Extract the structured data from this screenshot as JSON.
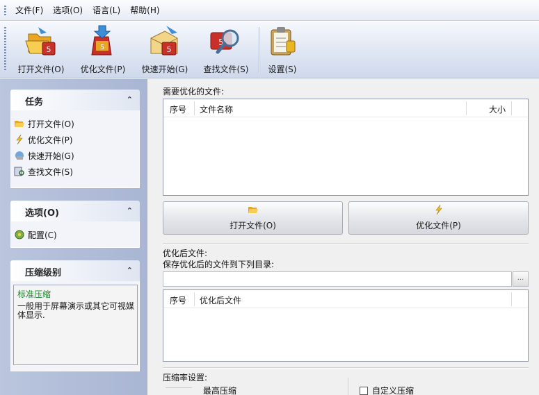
{
  "menu": [
    "文件(F)",
    "选项(O)",
    "语言(L)",
    "帮助(H)"
  ],
  "toolbar": {
    "open": "打开文件(O)",
    "optimize": "优化文件(P)",
    "quick": "快速开始(G)",
    "find": "查找文件(S)",
    "settings": "设置(S)"
  },
  "tasks": {
    "title": "任务",
    "items": [
      "打开文件(O)",
      "优化文件(P)",
      "快速开始(G)",
      "查找文件(S)"
    ]
  },
  "options": {
    "title": "选项(O)",
    "items": [
      "配置(C)"
    ]
  },
  "compression": {
    "title": "压缩级别",
    "level": "标准压缩",
    "description": "一般用于屏幕演示或其它可视媒体显示."
  },
  "files": {
    "label": "需要优化的文件:",
    "col_index": "序号",
    "col_name": "文件名称",
    "col_size": "大小"
  },
  "buttons": {
    "open": "打开文件(O)",
    "optimize": "优化文件(P)"
  },
  "output": {
    "label": "优化后文件:",
    "save_label": "保存优化后的文件到下列目录:",
    "path_value": "",
    "browse": "...",
    "col_index": "序号",
    "col_name": "优化后文件"
  },
  "ratio": {
    "label": "压缩率设置:",
    "max": "最高压缩",
    "custom": "自定义压缩"
  }
}
